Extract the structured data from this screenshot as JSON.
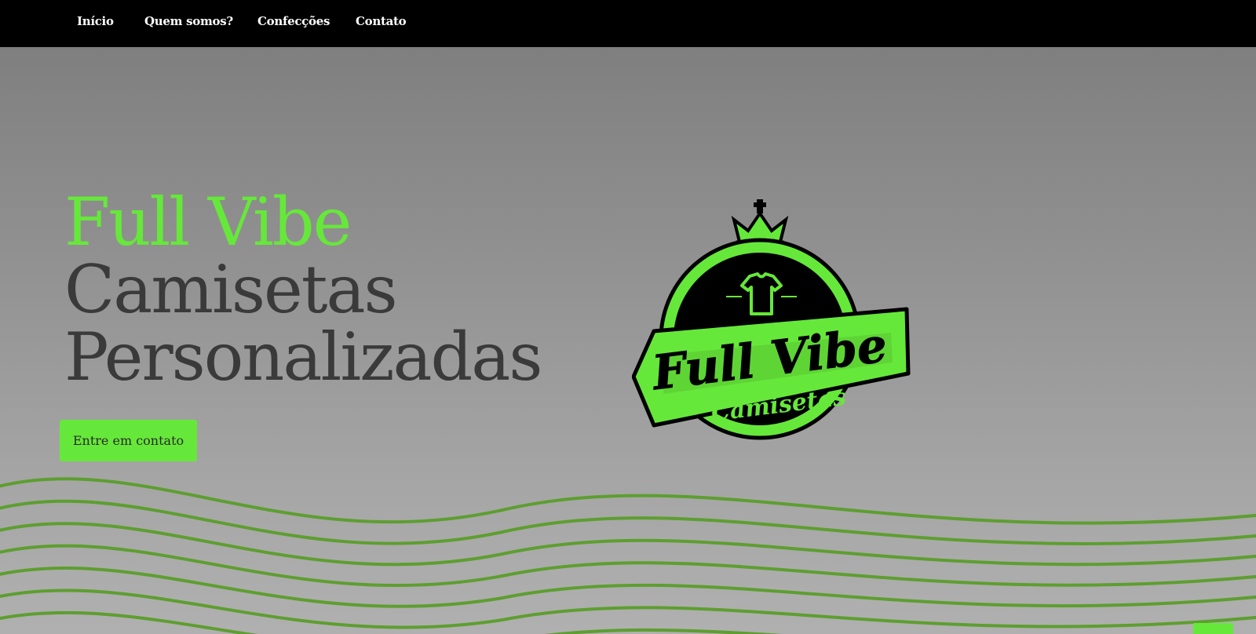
{
  "nav": {
    "items": [
      {
        "label": "Início"
      },
      {
        "label": "Quem somos?"
      },
      {
        "label": "Confecções"
      },
      {
        "label": "Contato"
      }
    ]
  },
  "hero": {
    "title_line1": "Full Vibe",
    "title_line2": "Camisetas",
    "title_line3": "Personalizadas",
    "cta_label": "Entre em contato"
  },
  "logo": {
    "script_text": "Full Vibe",
    "ribbon_text": "Camisetas",
    "icons": [
      "crown-icon",
      "tshirt-icon"
    ]
  },
  "whatsapp": {
    "icon": "whatsapp-icon"
  },
  "colors": {
    "accent": "#66e83a",
    "nav_background": "#000000",
    "title_dark": "#3a3a3a",
    "wave_lines": "#5a9e2a"
  }
}
